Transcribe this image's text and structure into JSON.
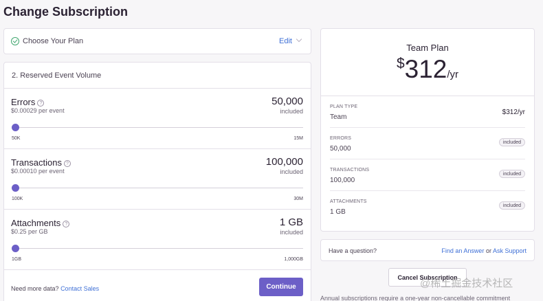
{
  "page": {
    "title": "Change Subscription"
  },
  "step1": {
    "label": "Choose Your Plan",
    "edit_label": "Edit"
  },
  "step2": {
    "title": "2.  Reserved Event Volume",
    "volumes": [
      {
        "name": "Errors",
        "price": "$0.00029 per event",
        "amount": "50,000",
        "included": "included",
        "min": "50K",
        "max": "15M",
        "slider_fraction": 0
      },
      {
        "name": "Transactions",
        "price": "$0.00010 per event",
        "amount": "100,000",
        "included": "included",
        "min": "100K",
        "max": "30M",
        "slider_fraction": 0
      },
      {
        "name": "Attachments",
        "price": "$0.25 per GB",
        "amount": "1 GB",
        "included": "included",
        "min": "1GB",
        "max": "1,000GB",
        "slider_fraction": 0
      }
    ],
    "more_text": "Need more data?",
    "contact_sales": "Contact Sales",
    "continue_label": "Continue"
  },
  "summary": {
    "plan_name": "Team Plan",
    "currency": "$",
    "price": "312",
    "period": "/yr",
    "rows": [
      {
        "key": "PLAN TYPE",
        "value": "Team",
        "right": "$312/yr"
      },
      {
        "key": "ERRORS",
        "value": "50,000",
        "badge": "included"
      },
      {
        "key": "TRANSACTIONS",
        "value": "100,000",
        "badge": "included"
      },
      {
        "key": "ATTACHMENTS",
        "value": "1 GB",
        "badge": "included"
      }
    ]
  },
  "help": {
    "question": "Have a question?",
    "find_answer": "Find an Answer",
    "or": "or",
    "ask_support": "Ask Support"
  },
  "cancel_label": "Cancel Subscription",
  "note": "Annual subscriptions require a one-year non-cancellable commitment",
  "watermark": "@稀土掘金技术社区",
  "colors": {
    "accent": "#6c5fc7",
    "link": "#3e6fd6",
    "success": "#3fa66e"
  }
}
